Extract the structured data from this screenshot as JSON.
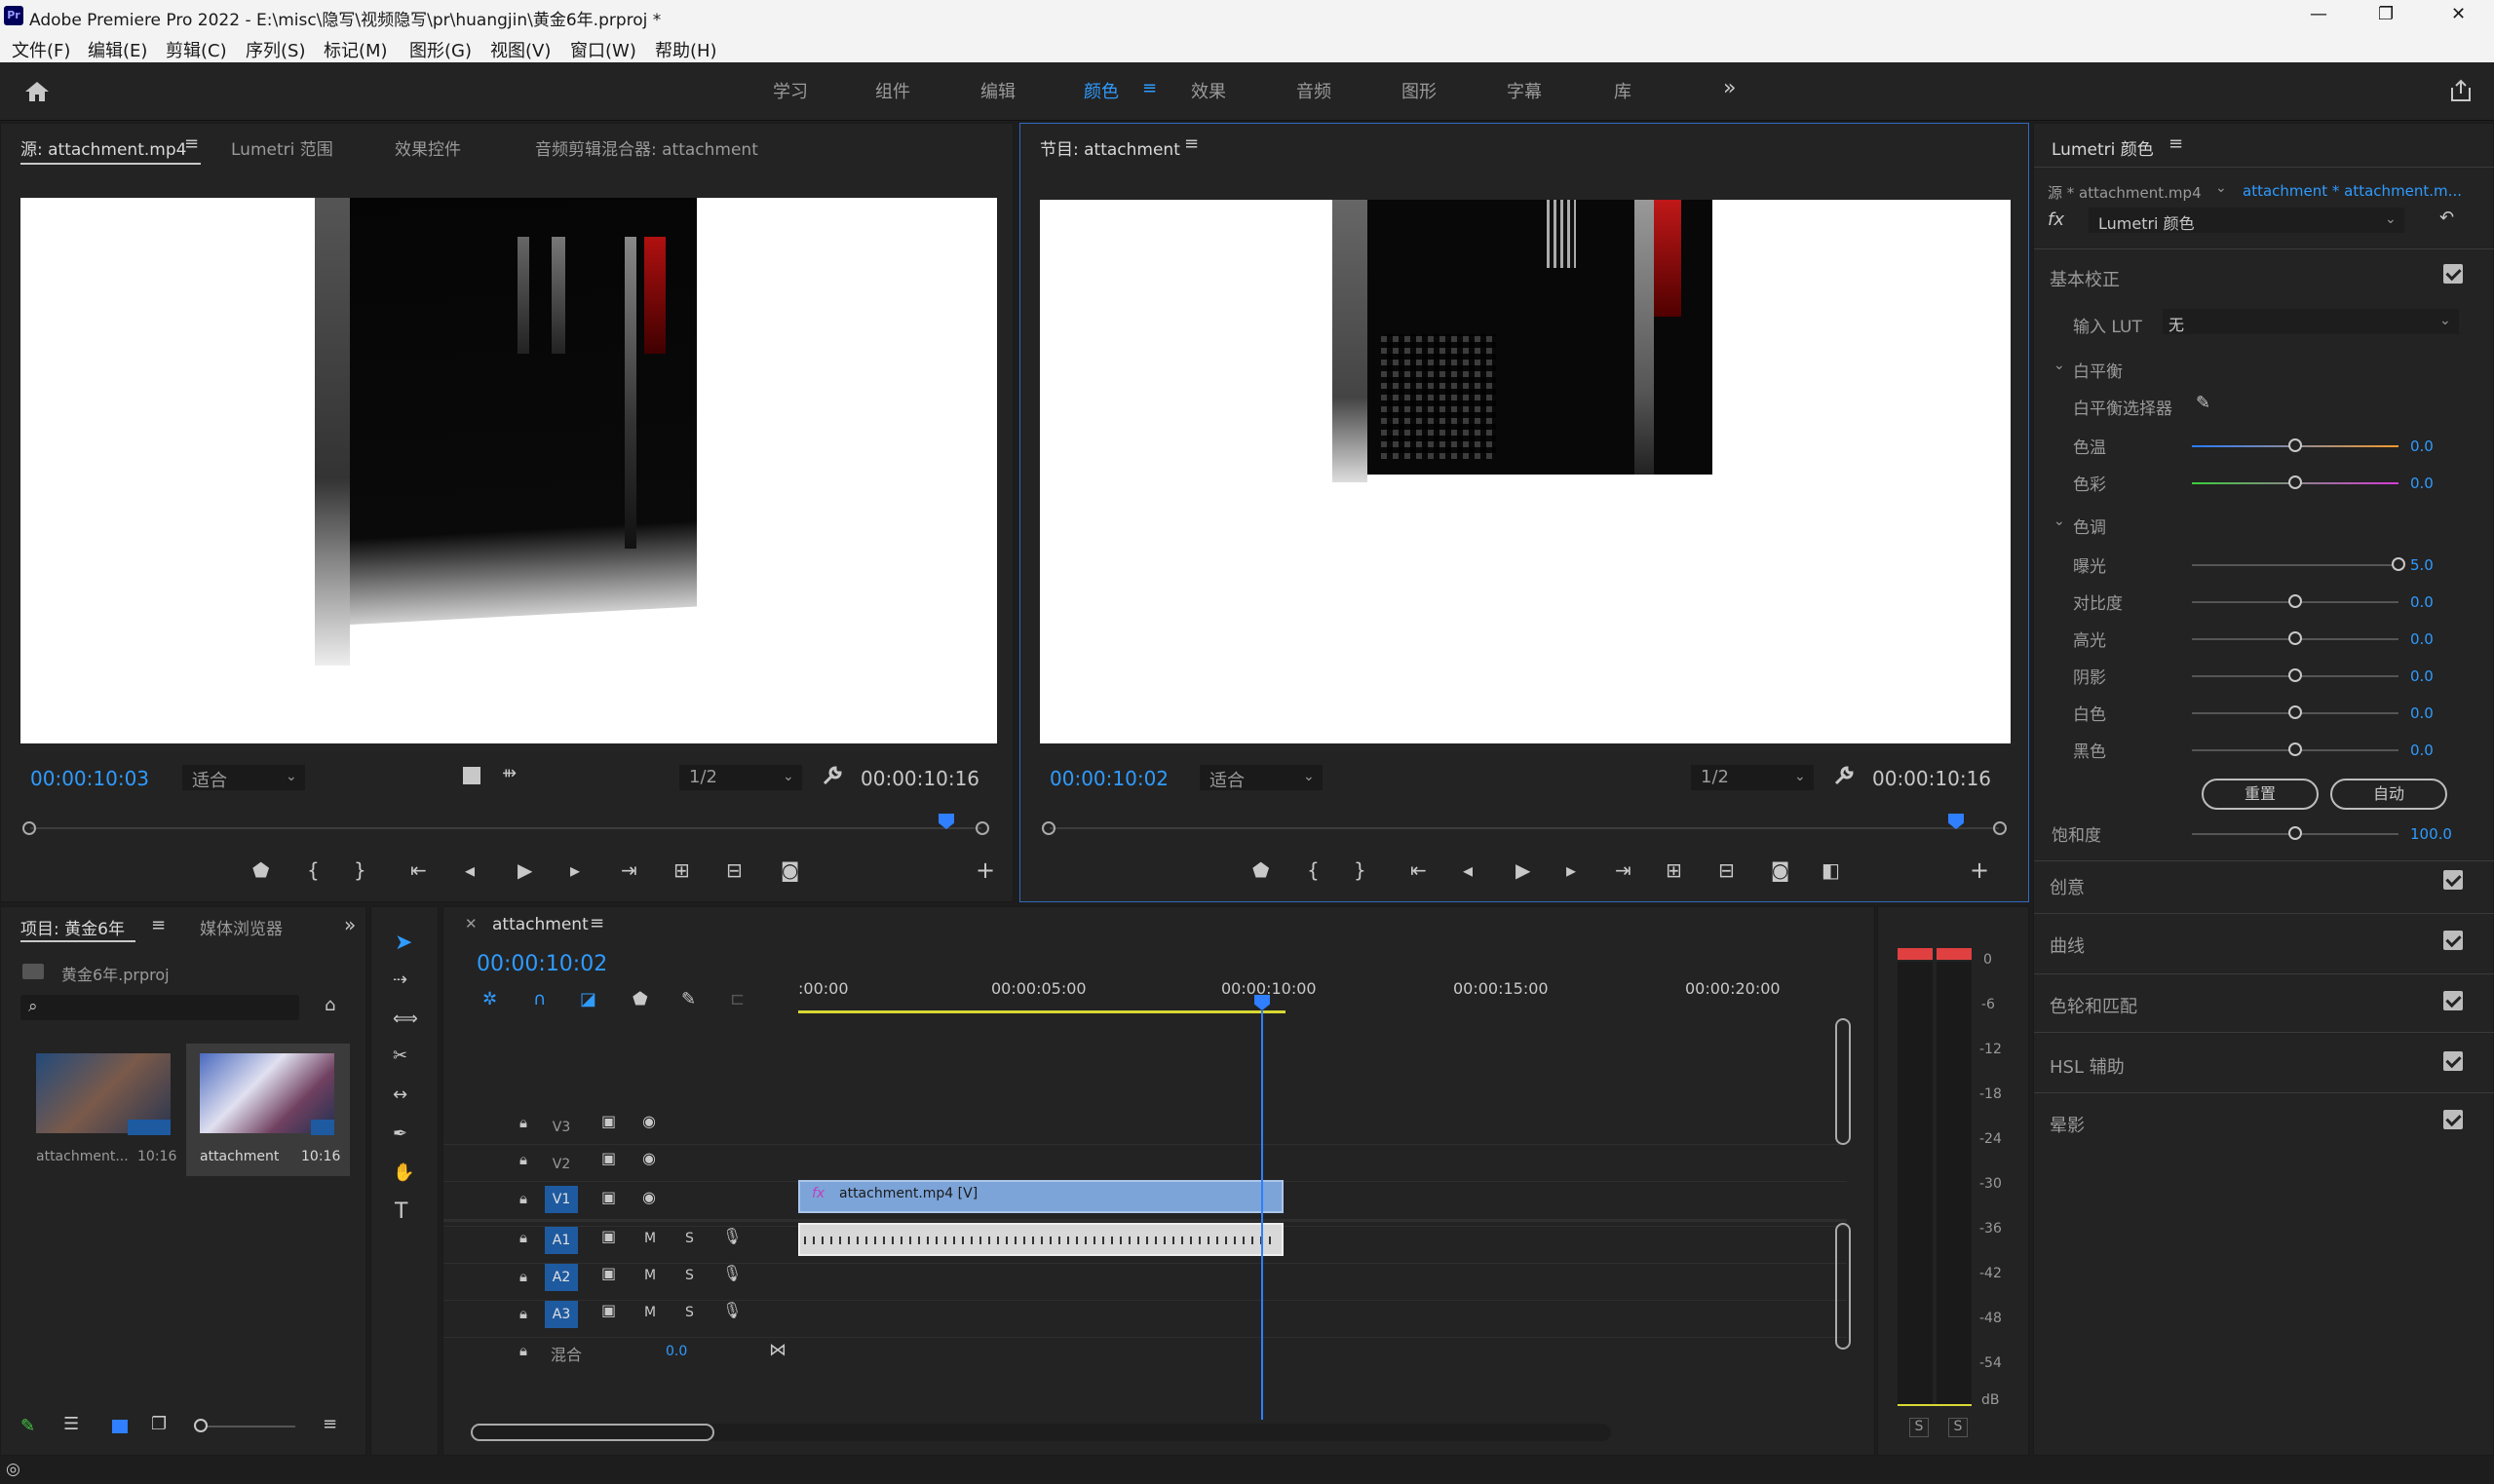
{
  "window": {
    "title": "Adobe Premiere Pro 2022 - E:\\misc\\隐写\\视频隐写\\pr\\huangjin\\黄金6年.prproj *",
    "logo": "Pr",
    "minimize": "—",
    "maximize": "❐",
    "close": "✕"
  },
  "menu": [
    "文件(F)",
    "编辑(E)",
    "剪辑(C)",
    "序列(S)",
    "标记(M)",
    "图形(G)",
    "视图(V)",
    "窗口(W)",
    "帮助(H)"
  ],
  "workspaces": [
    "学习",
    "组件",
    "编辑",
    "颜色",
    "效果",
    "音频",
    "图形",
    "字幕",
    "库"
  ],
  "workspace_active": "颜色",
  "source_panel": {
    "tabs": [
      "源: attachment.mp4",
      "Lumetri 范围",
      "效果控件",
      "音频剪辑混合器: attachment"
    ],
    "timecode": "00:00:10:03",
    "fit": "适合",
    "resolution": "1/2",
    "duration": "00:00:10:16"
  },
  "program_panel": {
    "tab": "节目: attachment",
    "timecode": "00:00:10:02",
    "fit": "适合",
    "resolution": "1/2",
    "duration": "00:00:10:16"
  },
  "lumetri": {
    "title": "Lumetri 颜色",
    "source": "源 * attachment.mp4",
    "sequence": "attachment * attachment.m...",
    "effect": "Lumetri 颜色",
    "basic": "基本校正",
    "input_lut_label": "输入 LUT",
    "input_lut_value": "无",
    "white_balance": "白平衡",
    "wb_selector": "白平衡选择器",
    "tone": "色调",
    "sliders": [
      {
        "label": "色温",
        "value": "0.0",
        "pos": 0.5
      },
      {
        "label": "色彩",
        "value": "0.0",
        "pos": 0.5
      },
      {
        "label": "曝光",
        "value": "5.0",
        "pos": 1.0
      },
      {
        "label": "对比度",
        "value": "0.0",
        "pos": 0.5
      },
      {
        "label": "高光",
        "value": "0.0",
        "pos": 0.5
      },
      {
        "label": "阴影",
        "value": "0.0",
        "pos": 0.5
      },
      {
        "label": "白色",
        "value": "0.0",
        "pos": 0.5
      },
      {
        "label": "黑色",
        "value": "0.0",
        "pos": 0.5
      }
    ],
    "reset": "重置",
    "auto": "自动",
    "saturation_label": "饱和度",
    "saturation_value": "100.0",
    "saturation_pos": 0.5,
    "sections": [
      "创意",
      "曲线",
      "色轮和匹配",
      "HSL 辅助",
      "晕影"
    ]
  },
  "project_panel": {
    "tab": "项目: 黄金6年",
    "tab2": "媒体浏览器",
    "file": "黄金6年.prproj",
    "items": [
      {
        "name": "attachment...",
        "duration": "10:16"
      },
      {
        "name": "attachment",
        "duration": "10:16"
      }
    ]
  },
  "timeline": {
    "tab": "attachment",
    "timecode": "00:00:10:02",
    "ruler": [
      ":00:00",
      "00:00:05:00",
      "00:00:10:00",
      "00:00:15:00",
      "00:00:20:00"
    ],
    "video_tracks": [
      "V3",
      "V2",
      "V1"
    ],
    "audio_tracks": [
      "A1",
      "A2",
      "A3"
    ],
    "mix_label": "混合",
    "mix_value": "0.0",
    "clip_label": "attachment.mp4 [V]"
  },
  "meter": {
    "scale": [
      "0",
      "-6",
      "-12",
      "-18",
      "-24",
      "-30",
      "-36",
      "-42",
      "-48",
      "-54",
      "dB"
    ],
    "solo": [
      "S",
      "S"
    ]
  }
}
